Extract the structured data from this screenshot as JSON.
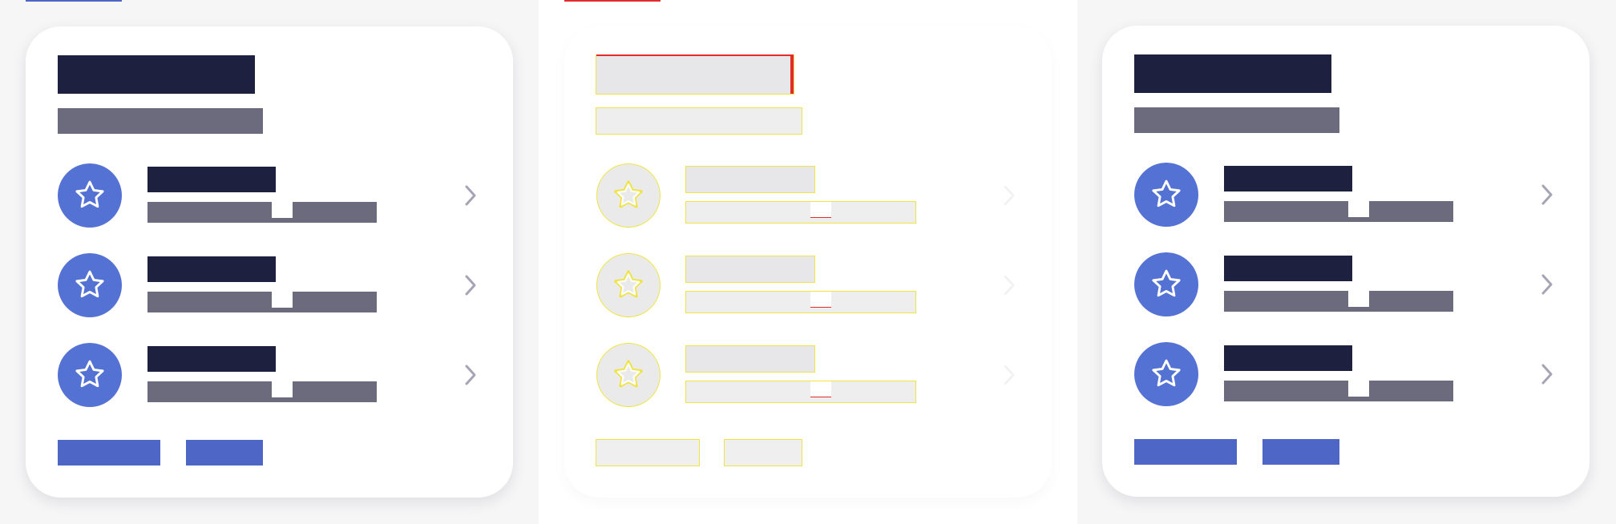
{
  "colors": {
    "page_background": "#eeeef0",
    "card_background": "#ffffff",
    "title_bar": "#1e2040",
    "subtitle_bar": "#6b6b7d",
    "accent": "#5472d4",
    "button": "#4e66c6",
    "chevron": "#a4a4b5",
    "skeleton_fill": "#e7e7e9",
    "skeleton_outline": "#f0e443",
    "skeleton_error": "#e22b2b",
    "top_accent_left": "#4e66c6",
    "top_accent_middle": "#e22b2b"
  },
  "panels": [
    {
      "variant": "solid",
      "top_accent_color": "#4e66c6",
      "card": {
        "list": [
          {
            "icon": "star-icon",
            "action_icon": "chevron-right-icon"
          },
          {
            "icon": "star-icon",
            "action_icon": "chevron-right-icon"
          },
          {
            "icon": "star-icon",
            "action_icon": "chevron-right-icon"
          }
        ],
        "buttons": [
          "primary",
          "secondary"
        ]
      }
    },
    {
      "variant": "skeleton",
      "top_accent_color": "#e22b2b",
      "card": {
        "list": [
          {
            "icon": "star-icon",
            "action_icon": "chevron-right-icon"
          },
          {
            "icon": "star-icon",
            "action_icon": "chevron-right-icon"
          },
          {
            "icon": "star-icon",
            "action_icon": "chevron-right-icon"
          }
        ],
        "buttons": [
          "primary",
          "secondary"
        ]
      }
    },
    {
      "variant": "solid",
      "top_accent_color": "",
      "card": {
        "list": [
          {
            "icon": "star-icon",
            "action_icon": "chevron-right-icon"
          },
          {
            "icon": "star-icon",
            "action_icon": "chevron-right-icon"
          },
          {
            "icon": "star-icon",
            "action_icon": "chevron-right-icon"
          }
        ],
        "buttons": [
          "primary",
          "secondary"
        ]
      }
    }
  ]
}
